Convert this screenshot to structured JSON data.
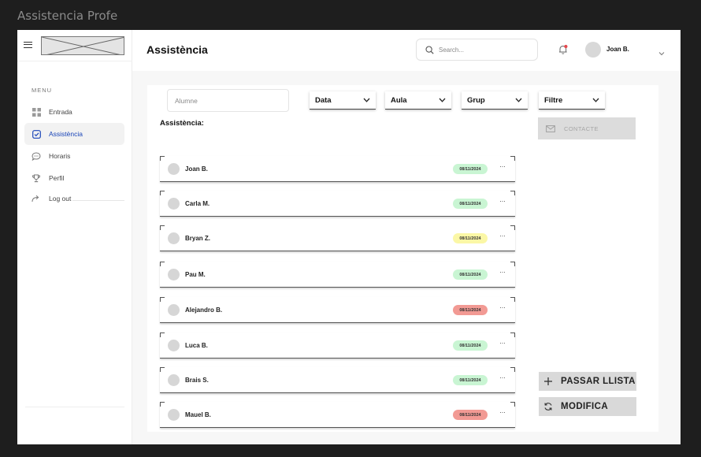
{
  "frame_title": "Assistencia Profe",
  "sidebar": {
    "menu_label": "MENU",
    "items": [
      {
        "label": "Entrada",
        "icon": "grid-icon"
      },
      {
        "label": "Assistència",
        "icon": "checkbox-icon",
        "active": true
      },
      {
        "label": "Horaris",
        "icon": "chat-bubble-icon"
      },
      {
        "label": "Perfil",
        "icon": "trophy-icon"
      },
      {
        "label": "Log out",
        "icon": "logout-arrow-icon"
      }
    ]
  },
  "header": {
    "title": "Assistència",
    "search_placeholder": "Search...",
    "user_name": "Joan B."
  },
  "filters": {
    "alumne_placeholder": "Alumne",
    "dropdowns": [
      "Data",
      "Aula",
      "Grup",
      "Filtre"
    ]
  },
  "section_label": "Assistència:",
  "contacte_label": "CONTACTE",
  "students": [
    {
      "name": "Joan B.",
      "date": "08/11/2024",
      "status": "present"
    },
    {
      "name": "Carla M.",
      "date": "08/11/2024",
      "status": "present"
    },
    {
      "name": "Bryan Z.",
      "date": "08/11/2024",
      "status": "late"
    },
    {
      "name": "Pau M.",
      "date": "08/11/2024",
      "status": "present"
    },
    {
      "name": "Alejandro B.",
      "date": "08/11/2024",
      "status": "absent"
    },
    {
      "name": "Luca B.",
      "date": "08/11/2024",
      "status": "present"
    },
    {
      "name": "Brais S.",
      "date": "08/11/2024",
      "status": "present"
    },
    {
      "name": "Mauel B.",
      "date": "08/11/2024",
      "status": "absent"
    }
  ],
  "status_colors": {
    "present": "#c9f5d3",
    "late": "#fbf7a6",
    "absent": "#f29a94"
  },
  "actions": {
    "passar_llista": "PASSAR LLISTA",
    "modifica": "MODIFICA"
  },
  "colors": {
    "accent": "#1a45b8",
    "button_gray": "#d9d9d9"
  }
}
